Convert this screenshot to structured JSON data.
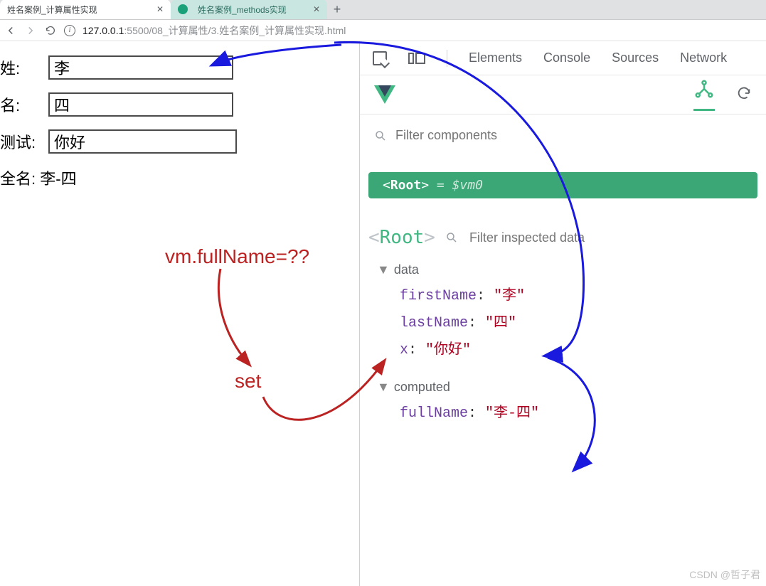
{
  "browser": {
    "tabs": [
      {
        "title": "姓名案例_计算属性实现",
        "active": true
      },
      {
        "title": "姓名案例_methods实现",
        "active": false
      }
    ],
    "url_host": "127.0.0.1",
    "url_port": ":5500",
    "url_path": "/08_计算属性/3.姓名案例_计算属性实现.html"
  },
  "form": {
    "xing_label": "姓:",
    "xing_value": "李",
    "ming_label": "名:",
    "ming_value": "四",
    "test_label": "测试:",
    "test_value": "你好",
    "fullname_label": "全名:",
    "fullname_value": "李-四"
  },
  "devtools": {
    "tabs": {
      "elements": "Elements",
      "console": "Console",
      "sources": "Sources",
      "network": "Network"
    },
    "filter_components_placeholder": "Filter components",
    "root_badge_prefix": "<",
    "root_badge_name": "Root",
    "root_badge_suffix": "> ",
    "root_badge_eq": "= $vm0",
    "root_tag": "Root",
    "filter_inspected_placeholder": "Filter inspected data",
    "sections": {
      "data": {
        "title": "data",
        "items": [
          {
            "key": "firstName",
            "val": "\"李\""
          },
          {
            "key": "lastName",
            "val": "\"四\""
          },
          {
            "key": "x",
            "val": "\"你好\""
          }
        ]
      },
      "computed": {
        "title": "computed",
        "items": [
          {
            "key": "fullName",
            "val": "\"李-四\""
          }
        ]
      }
    }
  },
  "annotations": {
    "q": "vm.fullName=??",
    "set": "set"
  },
  "watermark": "CSDN @哲子君"
}
